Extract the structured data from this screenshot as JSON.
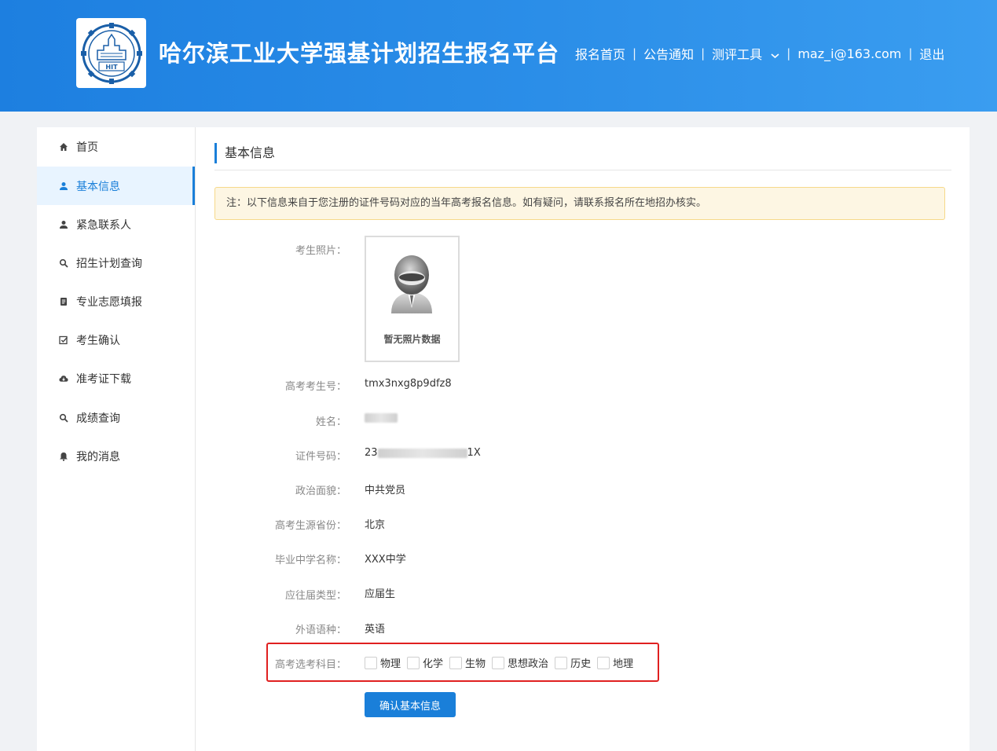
{
  "header": {
    "logo_text": "HIT",
    "title": "哈尔滨工业大学强基计划招生报名平台",
    "nav": {
      "home": "报名首页",
      "notices": "公告通知",
      "tools": "测评工具",
      "user": "maz_i@163.com",
      "logout": "退出"
    },
    "separator": "|",
    "chevron": "⌄"
  },
  "sidebar": {
    "items": [
      {
        "label": "首页",
        "icon": "home-icon"
      },
      {
        "label": "基本信息",
        "icon": "user-icon",
        "active": true
      },
      {
        "label": "紧急联系人",
        "icon": "user-icon"
      },
      {
        "label": "招生计划查询",
        "icon": "search-icon"
      },
      {
        "label": "专业志愿填报",
        "icon": "document-icon"
      },
      {
        "label": "考生确认",
        "icon": "checkbox-icon"
      },
      {
        "label": "准考证下载",
        "icon": "cloud-download-icon"
      },
      {
        "label": "成绩查询",
        "icon": "search-icon"
      },
      {
        "label": "我的消息",
        "icon": "bell-icon"
      }
    ]
  },
  "main": {
    "section_title": "基本信息",
    "notice": "注：以下信息来自于您注册的证件号码对应的当年高考报名信息。如有疑问，请联系报名所在地招办核实。",
    "photo": {
      "label": "考生照片：",
      "caption": "暂无照片数据"
    },
    "fields": {
      "exam_no": {
        "label": "高考考生号：",
        "value": "tmx3nxg8p9dfz8"
      },
      "name": {
        "label": "姓名："
      },
      "id_no": {
        "label": "证件号码：",
        "prefix": "23",
        "suffix": "1X"
      },
      "political": {
        "label": "政治面貌：",
        "value": "中共党员"
      },
      "province": {
        "label": "高考生源省份：",
        "value": "北京"
      },
      "school": {
        "label": "毕业中学名称：",
        "value": "XXX中学"
      },
      "grad_type": {
        "label": "应往届类型：",
        "value": "应届生"
      },
      "language": {
        "label": "外语语种：",
        "value": "英语"
      },
      "subjects": {
        "label": "高考选考科目：",
        "options": [
          "物理",
          "化学",
          "生物",
          "思想政治",
          "历史",
          "地理"
        ]
      }
    },
    "confirm_button": "确认基本信息"
  },
  "colors": {
    "header_blue": "#1d7fe0",
    "accent": "#1a7fd9",
    "notice_bg": "#fdf6e3",
    "highlight_red": "#e02020"
  }
}
